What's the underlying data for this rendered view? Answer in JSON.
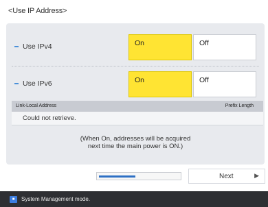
{
  "page": {
    "title": "<Use IP Address>"
  },
  "ipv4": {
    "label": "Use IPv4",
    "on_label": "On",
    "off_label": "Off",
    "selected": "On"
  },
  "ipv6": {
    "label": "Use IPv6",
    "on_label": "On",
    "off_label": "Off",
    "selected": "On"
  },
  "table": {
    "headers": {
      "address": "Link-Local Address",
      "prefix": "Prefix Length"
    },
    "message": "Could not retrieve."
  },
  "note": {
    "line1": "(When On, addresses will be acquired",
    "line2": "next time the main power is ON.)"
  },
  "footer": {
    "next_label": "Next",
    "progress": 0.45
  },
  "status_bar": {
    "text": "System Management mode."
  },
  "colors": {
    "selected": "#ffe433",
    "accent": "#2d6fc4",
    "status_bg": "#2e2f33"
  },
  "icons": {
    "bullet": "dash-bullet-icon",
    "next": "arrow-right-icon",
    "status": "system-management-icon"
  }
}
